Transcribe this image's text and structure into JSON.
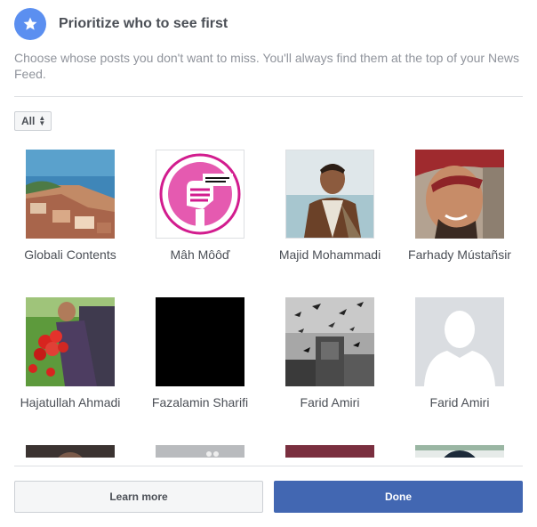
{
  "dialog": {
    "title": "Prioritize who to see first",
    "description": "Choose whose posts you don't want to miss. You'll always find them at the top of your News Feed.",
    "icon": "star-icon",
    "accent_color": "#4267b2"
  },
  "filter": {
    "selected": "All"
  },
  "people": [
    {
      "name": "Globali Contents",
      "image": "coastal-town-photo"
    },
    {
      "name": "Mâh Môôď",
      "image": "pink-fist-logo"
    },
    {
      "name": "Majid Mohammadi",
      "image": "young-man-photo"
    },
    {
      "name": "Farhady Mústañsir",
      "image": "smiling-man-photo"
    },
    {
      "name": "Hajatullah Ahmadi",
      "image": "man-with-flowers-photo"
    },
    {
      "name": "Fazalamin Sharifi",
      "image": "black-photo"
    },
    {
      "name": "Farid Amiri",
      "image": "birds-collage-photo"
    },
    {
      "name": "Farid Amiri",
      "image": "default-avatar"
    },
    {
      "name": "",
      "image": "partial-photo"
    },
    {
      "name": "",
      "image": "partial-photo"
    },
    {
      "name": "",
      "image": "partial-photo"
    },
    {
      "name": "",
      "image": "partial-photo"
    }
  ],
  "footer": {
    "learn_more_label": "Learn more",
    "done_label": "Done"
  }
}
